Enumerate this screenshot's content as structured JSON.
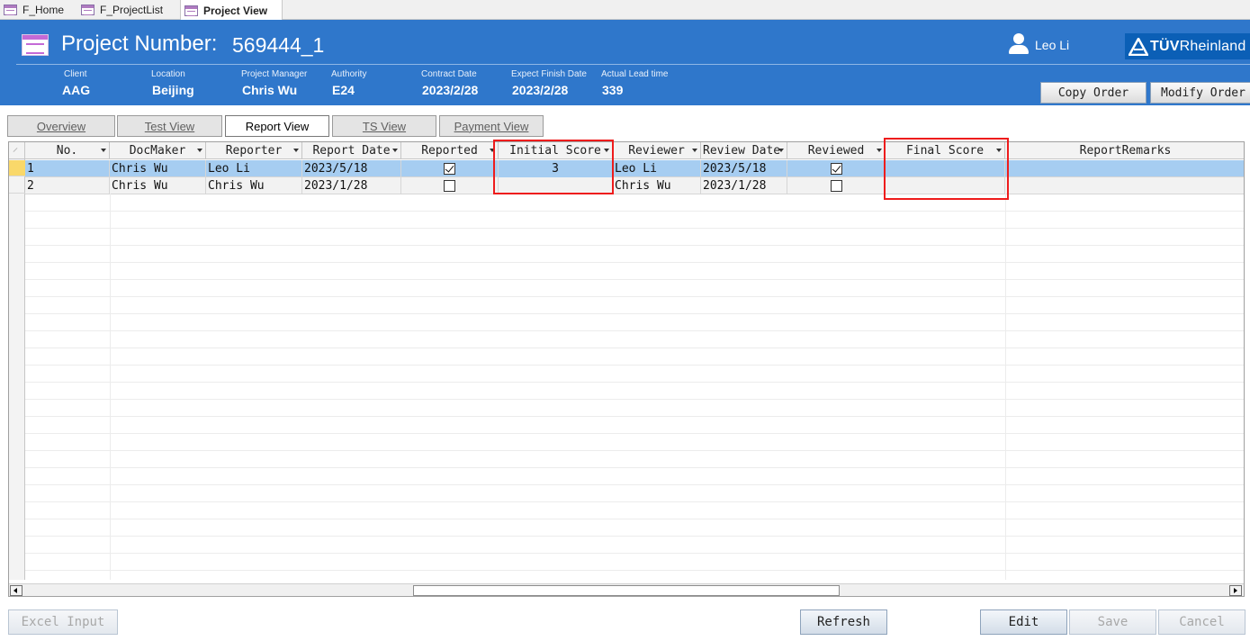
{
  "doc_tabs": [
    "F_Home",
    "F_ProjectList",
    "Project View"
  ],
  "header": {
    "project_label": "Project Number:",
    "project_number": "569444_1",
    "user_name": "Leo Li",
    "logo_tuv": "TÜV",
    "logo_rheinland": "Rheinland"
  },
  "info": [
    {
      "label": "Client",
      "value": "AAG"
    },
    {
      "label": "Location",
      "value": "Beijing"
    },
    {
      "label": "Project Manager",
      "value": "Chris Wu"
    },
    {
      "label": "Authority",
      "value": "E24"
    },
    {
      "label": "Contract Date",
      "value": "2023/2/28"
    },
    {
      "label": "Expect Finish Date",
      "value": "2023/2/28"
    },
    {
      "label": "Actual Lead time",
      "value": "339"
    }
  ],
  "header_buttons": {
    "copy_order": "Copy Order",
    "modify_order": "Modify Order"
  },
  "view_tabs": [
    "Overview",
    "Test View",
    "Report View",
    "TS View",
    "Payment View"
  ],
  "active_view_tab": "Report View",
  "columns": [
    "No.",
    "DocMaker",
    "Reporter",
    "Report Date",
    "Reported",
    "Initial Score",
    "Reviewer",
    "Review Date",
    "Reviewed",
    "Final Score",
    "ReportRemarks"
  ],
  "rows": [
    {
      "no": "1",
      "docmaker": "Chris Wu",
      "reporter": "Leo Li",
      "report_date": "2023/5/18",
      "reported": true,
      "initial_score": "3",
      "reviewer": "Leo Li",
      "review_date": "2023/5/18",
      "reviewed": true,
      "final_score": "",
      "remarks": ""
    },
    {
      "no": "2",
      "docmaker": "Chris Wu",
      "reporter": "Chris Wu",
      "report_date": "2023/1/28",
      "reported": false,
      "initial_score": "",
      "reviewer": "Chris Wu",
      "review_date": "2023/1/28",
      "reviewed": false,
      "final_score": "",
      "remarks": ""
    }
  ],
  "bottom_buttons": {
    "excel_input": "Excel Input",
    "refresh": "Refresh",
    "edit": "Edit",
    "save": "Save",
    "cancel": "Cancel"
  },
  "colors": {
    "header_blue": "#2f77cb",
    "selected_row": "#a6cdf1",
    "current_record": "#f9d86a",
    "highlight_red": "#ee1c1c",
    "logo_blue": "#0b5fb6"
  },
  "icons": {
    "form_tab": "form-icon",
    "project": "form-icon",
    "user": "user-icon",
    "logo": "tuv-triangle-logo"
  }
}
